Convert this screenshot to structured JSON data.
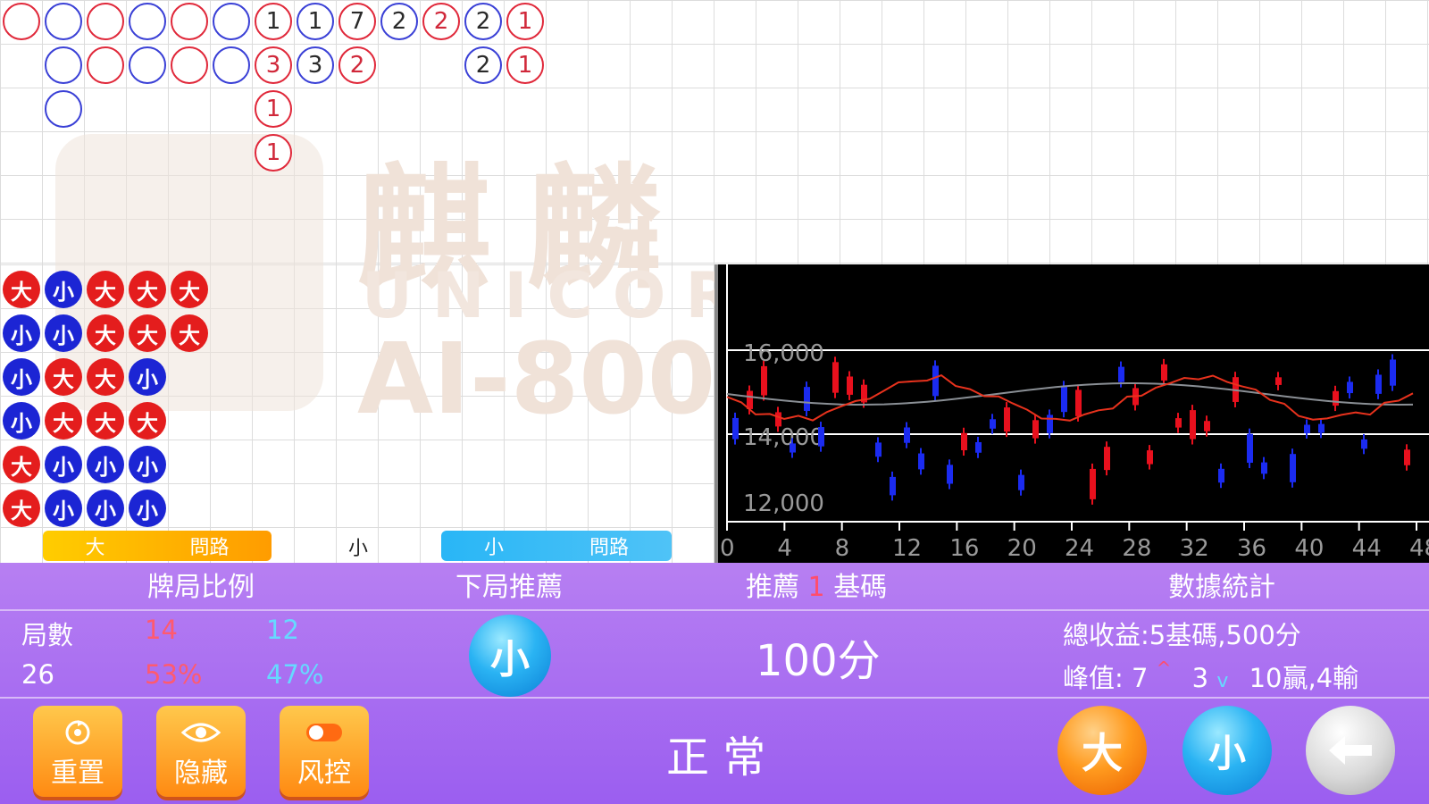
{
  "watermark": {
    "title": "麒麟",
    "brand": "UNICORN",
    "model": "AI-800"
  },
  "big_road": [
    {
      "c": "r",
      "t": ""
    },
    {
      "c": "b",
      "t": ""
    },
    {
      "c": "r",
      "t": ""
    },
    {
      "c": "b",
      "t": ""
    },
    {
      "c": "r",
      "t": ""
    },
    {
      "c": "b",
      "t": ""
    },
    {
      "c": "rk",
      "t": "1"
    },
    {
      "c": "k",
      "t": "1"
    },
    {
      "c": "rk",
      "t": "7"
    },
    {
      "c": "b",
      "t": "2"
    },
    {
      "c": "r",
      "t": "2"
    },
    {
      "c": "b",
      "t": "2"
    },
    {
      "c": "r",
      "t": "1"
    },
    {
      "c": "b",
      "t": ""
    },
    {
      "c": "r",
      "t": ""
    },
    {
      "c": "b",
      "t": ""
    },
    {
      "c": "r",
      "t": ""
    },
    {
      "c": "b",
      "t": ""
    },
    {
      "c": "r",
      "t": "3"
    },
    {
      "c": "k",
      "t": "3"
    },
    {
      "c": "r",
      "t": "2"
    },
    {
      "c": "b",
      "t": "2"
    },
    {
      "c": "r",
      "t": "1"
    },
    {
      "c": "b",
      "t": ""
    },
    {
      "c": "r",
      "t": "1"
    },
    {
      "c": "r",
      "t": "1"
    }
  ],
  "bead_rows": [
    [
      "大",
      "小",
      "大",
      "大",
      "大"
    ],
    [
      "小",
      "小",
      "大",
      "大",
      "大"
    ],
    [
      "小",
      "大",
      "大",
      "小"
    ],
    [
      "小",
      "大",
      "大",
      "大"
    ],
    [
      "大",
      "小",
      "小",
      "小"
    ],
    [
      "大",
      "小",
      "小",
      "小"
    ]
  ],
  "ask_road": {
    "big_label": "大",
    "big_ask": "問路",
    "center": "小",
    "small_label": "小",
    "small_ask": "問路"
  },
  "chart_data": {
    "type": "line",
    "y_ticks": [
      "12,000",
      "14,000",
      "16,000"
    ],
    "x_ticks": [
      "0",
      "4",
      "8",
      "12",
      "16",
      "20",
      "24",
      "28",
      "32",
      "36",
      "40",
      "44",
      "48"
    ]
  },
  "stats": {
    "ratio_header": "牌局比例",
    "next_header": "下局推薦",
    "rec_header_pre": "推薦",
    "rec_header_num": "1",
    "rec_header_post": "基碼",
    "data_header": "數據統計",
    "rounds_label": "局數",
    "rounds_value": "26",
    "big_count": "14",
    "small_count": "12",
    "big_pct": "53%",
    "small_pct": "47%",
    "next_pick": "小",
    "bet_amount": "100分",
    "total_profit": "總收益:5基碼,500分",
    "peak_label": "峰值:",
    "peak_up": "7",
    "up_mark": "^",
    "peak_down": "3",
    "down_mark": "v",
    "win_loss": "10贏,4輸"
  },
  "status": "正 常",
  "buttons": {
    "reset": "重置",
    "hide": "隐藏",
    "risk": "风控",
    "big": "大",
    "small": "小"
  },
  "colors": {
    "purple": "#a56cf1",
    "red": "#e41d1d",
    "blue": "#1c25d4",
    "orange": "#ff9a1e",
    "sky": "#2ab3f3"
  }
}
